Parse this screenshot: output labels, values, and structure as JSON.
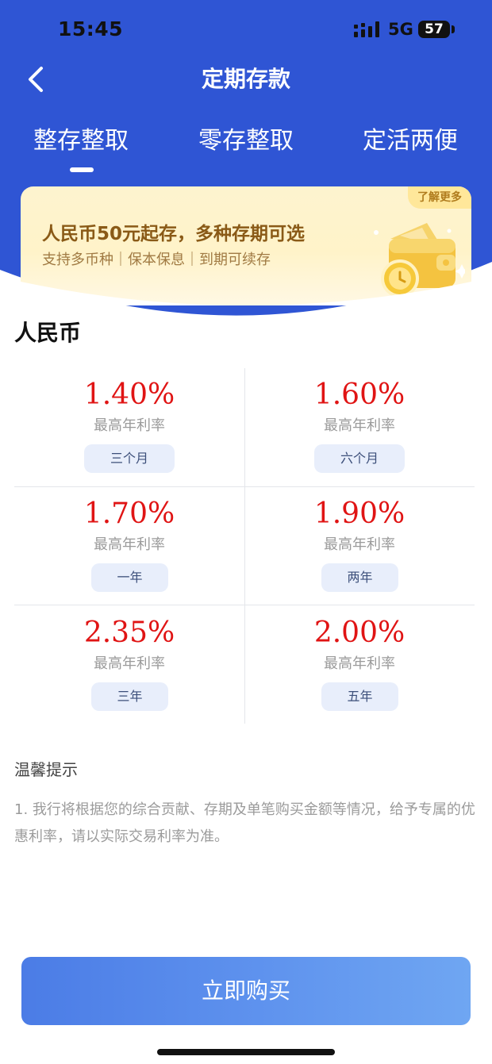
{
  "status_bar": {
    "time": "15:45",
    "network": "5G",
    "battery": "57",
    "battery_level": 0.57,
    "signal_icon": "signal-bars-icon"
  },
  "nav": {
    "back_icon": "chevron-left-icon",
    "title": "定期存款"
  },
  "tabs": [
    {
      "label": "整存整取",
      "active": true
    },
    {
      "label": "零存整取",
      "active": false
    },
    {
      "label": "定活两便",
      "active": false
    }
  ],
  "promo": {
    "main": "人民币50元起存，多种存期可选",
    "sub": "支持多币种｜保本保息｜到期可续存",
    "more": "了解更多",
    "art_icon": "wallet-clock-icon"
  },
  "section_title": "人民币",
  "rates": [
    {
      "rate": "1.40%",
      "label": "最高年利率",
      "term": "三个月"
    },
    {
      "rate": "1.60%",
      "label": "最高年利率",
      "term": "六个月"
    },
    {
      "rate": "1.70%",
      "label": "最高年利率",
      "term": "一年"
    },
    {
      "rate": "1.90%",
      "label": "最高年利率",
      "term": "两年"
    },
    {
      "rate": "2.35%",
      "label": "最高年利率",
      "term": "三年"
    },
    {
      "rate": "2.00%",
      "label": "最高年利率",
      "term": "五年"
    }
  ],
  "tips": {
    "title": "温馨提示",
    "text": "1. 我行将根据您的综合贡献、存期及单笔购买金额等情况，给予专属的优惠利率，请以实际交易利率为准。"
  },
  "buy_button": "立即购买",
  "colors": {
    "header_blue": "#2f55d4",
    "rate_red": "#e01414",
    "button_blue": "#5f93ee",
    "promo_gold": "#8a5a17"
  }
}
